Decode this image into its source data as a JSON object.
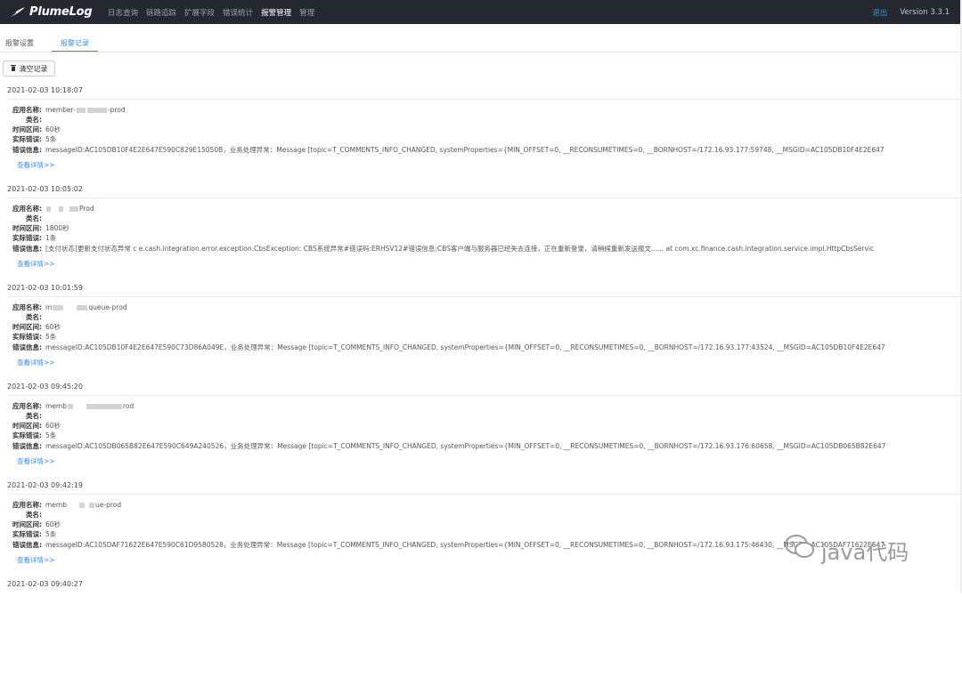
{
  "app": {
    "brand": "PlumeLog",
    "nav": [
      "日志查询",
      "链路追踪",
      "扩展字段",
      "错误统计",
      "报警管理",
      "管理"
    ],
    "active_nav": "报警管理",
    "logout": "退出",
    "version": "Version 3.3.1"
  },
  "tabs": {
    "settings": "报警设置",
    "records": "报警记录"
  },
  "clear_button": "清空记录",
  "labels": {
    "app_name": "应用名称:",
    "class_name": "类名:",
    "window": "时间区间:",
    "actual_errors": "实际错误:",
    "error_info": "错误信息:",
    "view_detail": "查看详情>>"
  },
  "records": [
    {
      "time": "2021-02-03 10:18:07",
      "app_prefix": "member-",
      "app_suffix": "-prod",
      "class_name": "",
      "window": "60秒",
      "count": "5条",
      "error": "messageID:AC105DB10F4E2E647E590C829E15050B，业务处理异常：Message [topic=T_COMMENTS_INFO_CHANGED, systemProperties={MIN_OFFSET=0, __RECONSUMETIMES=0, __BORNHOST=/172.16.93.177:59748, __MSGID=AC105DB10F4E2E647"
    },
    {
      "time": "2021-02-03 10:05:02",
      "app_prefix": "",
      "app_suffix": "Prod",
      "class_name": "",
      "window": "1800秒",
      "count": "1条",
      "error": "[支付状态]更新支付状态异常 c                e.cash.integration.error.exception.CbsException: CBS系统异常#错误码:ERHSV12#错误信息:CBS客户端与服务器已经失去连接，正在重新登录，请稍候重新发送报文...... at com.xc.finance.cash.integration.service.impl.HttpCbsServic"
    },
    {
      "time": "2021-02-03 10:01:59",
      "app_prefix": "m",
      "app_suffix": "queue-prod",
      "class_name": "",
      "window": "60秒",
      "count": "5条",
      "error": "messageID:AC105DB10F4E2E647E590C73D86A049E，业务处理异常：Message [topic=T_COMMENTS_INFO_CHANGED, systemProperties={MIN_OFFSET=0, __RECONSUMETIMES=0, __BORNHOST=/172.16.93.177:43524, __MSGID=AC105DB10F4E2E647"
    },
    {
      "time": "2021-02-03 09:45:20",
      "app_prefix": "memb",
      "app_suffix": "rod",
      "class_name": "",
      "window": "60秒",
      "count": "5条",
      "error": "messageID:AC105DB065B82E647E590C649A240526，业务处理异常：Message [topic=T_COMMENTS_INFO_CHANGED, systemProperties={MIN_OFFSET=0, __RECONSUMETIMES=0, __BORNHOST=/172.16.93.176:60658, __MSGID=AC105DB065B82E647"
    },
    {
      "time": "2021-02-03 09:42:19",
      "app_prefix": "memb",
      "app_suffix": "ue-prod",
      "class_name": "",
      "window": "60秒",
      "count": "5条",
      "error": "messageID:AC105DAF71622E647E590C61D9580528，业务处理异常：Message [topic=T_COMMENTS_INFO_CHANGED, systemProperties={MIN_OFFSET=0, __RECONSUMETIMES=0, __BORNHOST=/172.16.93.175:46430, __MSGID=AC105DAF71622E647"
    },
    {
      "time": "2021-02-03 09:40:27"
    }
  ],
  "watermark": "java代码",
  "colors": {
    "topbar": "#23292f",
    "accent": "#3a8ee6"
  }
}
